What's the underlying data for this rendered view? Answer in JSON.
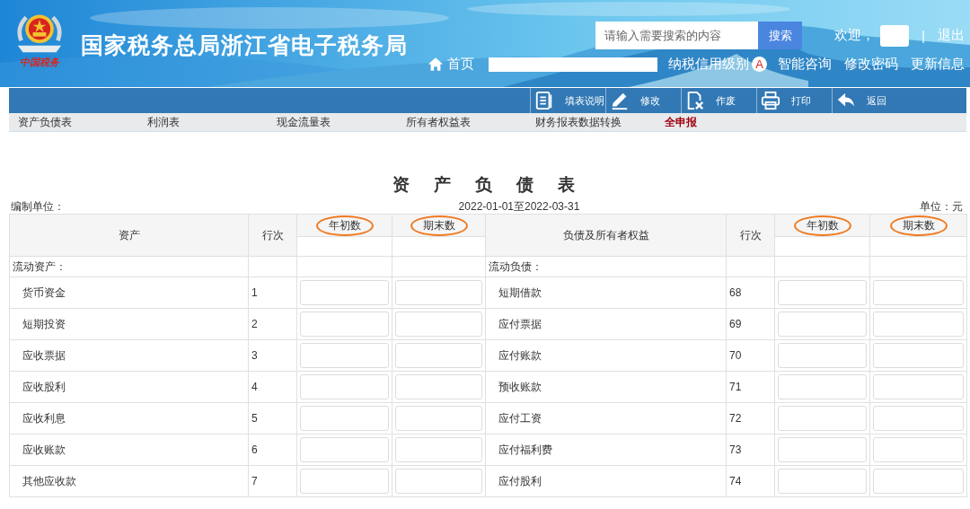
{
  "header": {
    "logo_caption": "中国税务",
    "site_title": "国家税务总局浙江省电子税务局",
    "search": {
      "placeholder": "请输入需要搜索的内容",
      "button": "搜索"
    },
    "welcome": "欢迎，",
    "separator": "|",
    "logout": "退出",
    "home": "首页",
    "credit_label": "纳税信用级别",
    "credit_grade": "A",
    "links": [
      "智能咨询",
      "修改密码",
      "更新信息"
    ]
  },
  "toolbar": [
    {
      "kind": "doc",
      "label": "填表说明"
    },
    {
      "kind": "edit",
      "label": "修改"
    },
    {
      "kind": "void",
      "label": "作废"
    },
    {
      "kind": "print",
      "label": "打印"
    },
    {
      "kind": "back",
      "label": "返回"
    }
  ],
  "tabs": [
    {
      "label": "资产负债表",
      "emphasis": false
    },
    {
      "label": "利润表",
      "emphasis": false
    },
    {
      "label": "现金流量表",
      "emphasis": false
    },
    {
      "label": "所有者权益表",
      "emphasis": false
    },
    {
      "label": "财务报表数据转换",
      "emphasis": false
    },
    {
      "label": "全申报",
      "emphasis": true
    }
  ],
  "report": {
    "title": "资　产　负　债　表",
    "unit_label": "编制单位：",
    "period": "2022-01-01至2022-03-31",
    "currency": "单位：元"
  },
  "table": {
    "columns": [
      {
        "label": "资产",
        "circled": false
      },
      {
        "label": "行次",
        "circled": false
      },
      {
        "label": "年初数",
        "circled": true
      },
      {
        "label": "期末数",
        "circled": true
      },
      {
        "label": "负债及所有者权益",
        "circled": false
      },
      {
        "label": "行次",
        "circled": false
      },
      {
        "label": "年初数",
        "circled": true
      },
      {
        "label": "期末数",
        "circled": true
      }
    ],
    "section_left": "流动资产：",
    "section_right": "流动负债：",
    "rows": [
      {
        "asset": "货币资金",
        "asset_line": "1",
        "liability": "短期借款",
        "liability_line": "68"
      },
      {
        "asset": "短期投资",
        "asset_line": "2",
        "liability": "应付票据",
        "liability_line": "69"
      },
      {
        "asset": "应收票据",
        "asset_line": "3",
        "liability": "应付账款",
        "liability_line": "70"
      },
      {
        "asset": "应收股利",
        "asset_line": "4",
        "liability": "预收账款",
        "liability_line": "71"
      },
      {
        "asset": "应收利息",
        "asset_line": "5",
        "liability": "应付工资",
        "liability_line": "72"
      },
      {
        "asset": "应收账款",
        "asset_line": "6",
        "liability": "应付福利费",
        "liability_line": "73"
      },
      {
        "asset": "其他应收款",
        "asset_line": "7",
        "liability": "应付股利",
        "liability_line": "74"
      }
    ]
  }
}
